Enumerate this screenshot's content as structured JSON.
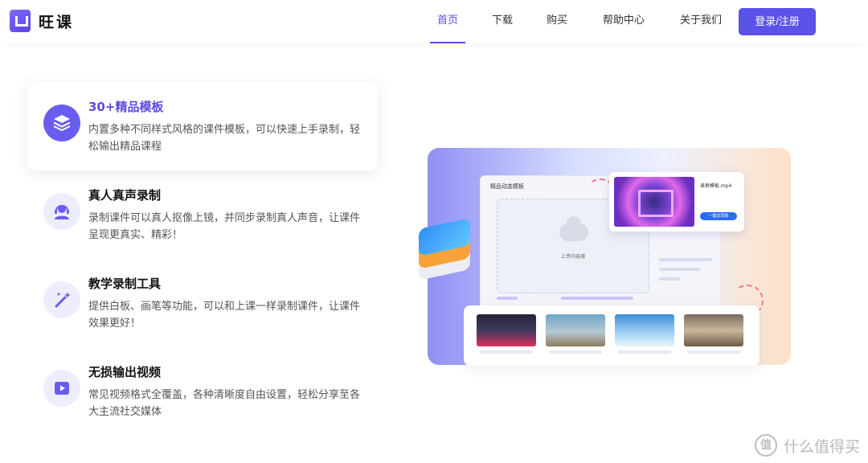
{
  "header": {
    "brand": "旺课",
    "nav": [
      "首页",
      "下载",
      "购买",
      "帮助中心",
      "关于我们"
    ],
    "active_nav": "首页",
    "login_label": "登录/注册"
  },
  "features": [
    {
      "title": "30+精品模板",
      "desc": "内置多种不同样式风格的课件模板，可以快速上手录制，轻松输出精品课程",
      "icon": "layers-icon",
      "selected": true
    },
    {
      "title": "真人真声录制",
      "desc": "录制课件可以真人抠像上镜，并同步录制真人声音，让课件呈现更真实、精彩！",
      "icon": "headset-person-icon",
      "selected": false
    },
    {
      "title": "教学录制工具",
      "desc": "提供白板、画笔等功能，可以和上课一样录制课件，让课件效果更好！",
      "icon": "magic-wand-icon",
      "selected": false
    },
    {
      "title": "无损输出视频",
      "desc": "常见视频格式全覆盖，各种清晰度自由设置，轻松分享至各大主流社交媒体",
      "icon": "video-play-icon",
      "selected": false
    }
  ],
  "illustration": {
    "panel_title": "精品动态模板",
    "upload_label": "上传内容源",
    "video_name": "录屏模板.mp4",
    "video_button": "一键去同款"
  },
  "watermark": {
    "mark": "值",
    "text": "什么值得买"
  },
  "colors": {
    "accent": "#5b4ce0",
    "button": "#5b52ea",
    "icon_bg": "#eeedfd"
  }
}
